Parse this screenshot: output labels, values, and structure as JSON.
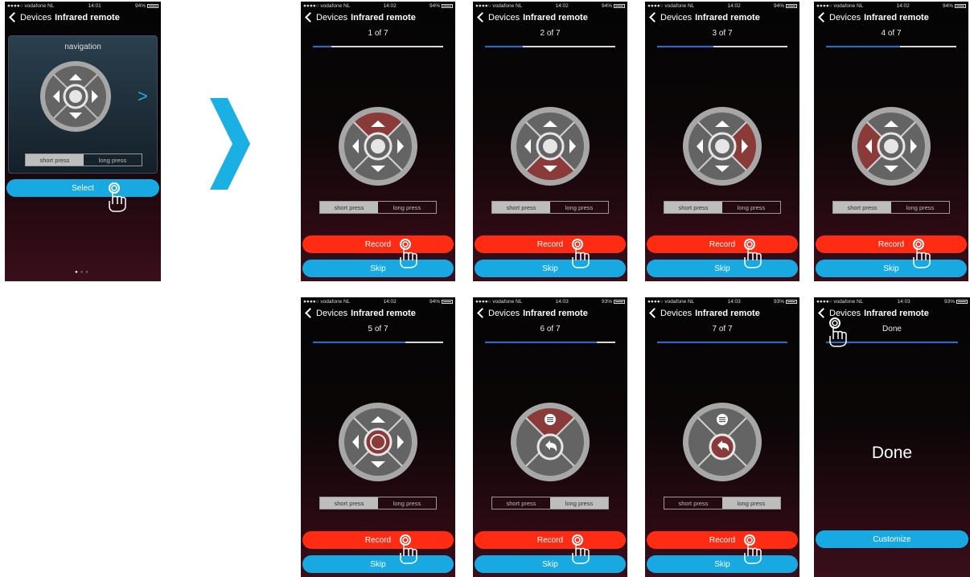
{
  "status_bar": {
    "screen1": {
      "carrier": "●●●●○ vodafone NL",
      "time": "14:01",
      "battery": "94%"
    },
    "screens": [
      {
        "carrier": "●●●●○ vodafone NL",
        "time": "14:02",
        "battery": "94%"
      },
      {
        "carrier": "●●●●○ vodafone NL",
        "time": "14:02",
        "battery": "94%"
      },
      {
        "carrier": "●●●●○ vodafone NL",
        "time": "14:02",
        "battery": "94%"
      },
      {
        "carrier": "●●●●○ vodafone NL",
        "time": "14:02",
        "battery": "94%"
      },
      {
        "carrier": "●●●●○ vodafone NL",
        "time": "14:02",
        "battery": "94%"
      },
      {
        "carrier": "●●●●○ vodafone NL",
        "time": "14:03",
        "battery": "93%"
      },
      {
        "carrier": "●●●●○ vodafone NL",
        "time": "14:03",
        "battery": "93%"
      },
      {
        "carrier": "●●●●○ vodafone NL",
        "time": "14:03",
        "battery": "93%"
      }
    ]
  },
  "nav": {
    "back_label": "Devices",
    "title": "Infrared remote"
  },
  "screen1": {
    "section_title": "navigation",
    "select_label": "Select",
    "next_glyph": ">"
  },
  "press_mode": {
    "short": "short press",
    "long": "long press"
  },
  "steps": [
    {
      "label": "1 of 7",
      "progress": 0.14,
      "highlight": "up",
      "mode": "short"
    },
    {
      "label": "2 of 7",
      "progress": 0.29,
      "highlight": "down",
      "mode": "short"
    },
    {
      "label": "3 of 7",
      "progress": 0.43,
      "highlight": "right",
      "mode": "short"
    },
    {
      "label": "4 of 7",
      "progress": 0.57,
      "highlight": "left",
      "mode": "short"
    },
    {
      "label": "5 of 7",
      "progress": 0.71,
      "highlight": "center",
      "mode": "short"
    },
    {
      "label": "6 of 7",
      "progress": 0.86,
      "highlight": "menu",
      "mode": "long"
    },
    {
      "label": "7 of 7",
      "progress": 1.0,
      "highlight": "back",
      "mode": "long"
    }
  ],
  "actions": {
    "record": "Record",
    "skip": "Skip"
  },
  "done": {
    "header": "Done",
    "big": "Done",
    "customize": "Customize",
    "progress": 1.0
  },
  "colors": {
    "accent": "#18a9e2",
    "record": "#ff2b12",
    "highlight": "#8b3a3a",
    "progress": "#1c6fd6"
  },
  "icons": [
    "chevron-left-icon",
    "hand-pointer-icon",
    "big-chevron-right-icon",
    "dpad-icon",
    "menu-list-icon",
    "back-arrow-icon"
  ]
}
